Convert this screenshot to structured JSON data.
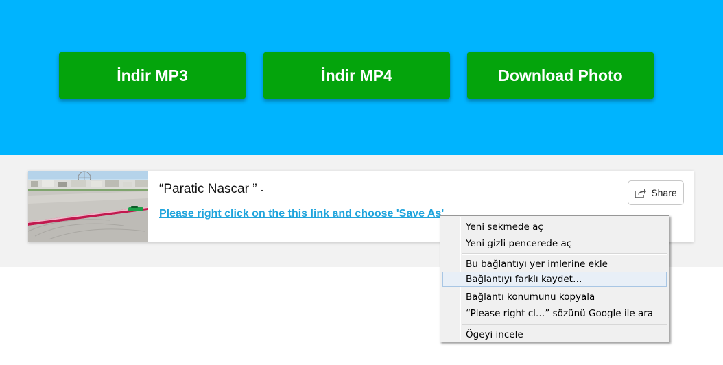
{
  "download_buttons": {
    "mp3_label": "İndir MP3",
    "mp4_label": "İndir MP4",
    "photo_label": "Download Photo"
  },
  "result": {
    "title": "“Paratic Nascar ”",
    "title_suffix": "-",
    "save_link_text": "Please right click on the this link and choose 'Save As'",
    "share_label": "Share",
    "share_icon": "share-icon",
    "thumbnail": "race-track-thumbnail"
  },
  "context_menu": {
    "items": [
      {
        "label": "Yeni sekmede aç"
      },
      {
        "label": "Yeni gizli pencerede aç"
      },
      {
        "label": "Bu bağlantıyı yer imlerine ekle"
      },
      {
        "label": "Bağlantıyı farklı kaydet…",
        "hovered": true
      },
      {
        "label": "Bağlantı konumunu kopyala"
      },
      {
        "label": "“Please right cl…” sözünü Google ile ara"
      },
      {
        "label": "Öğeyi incele"
      }
    ]
  },
  "colors": {
    "hero_background": "#00b4fe",
    "button_green": "#04a40c",
    "link_blue": "#1fa4dc",
    "band_grey": "#f2f2f2"
  }
}
